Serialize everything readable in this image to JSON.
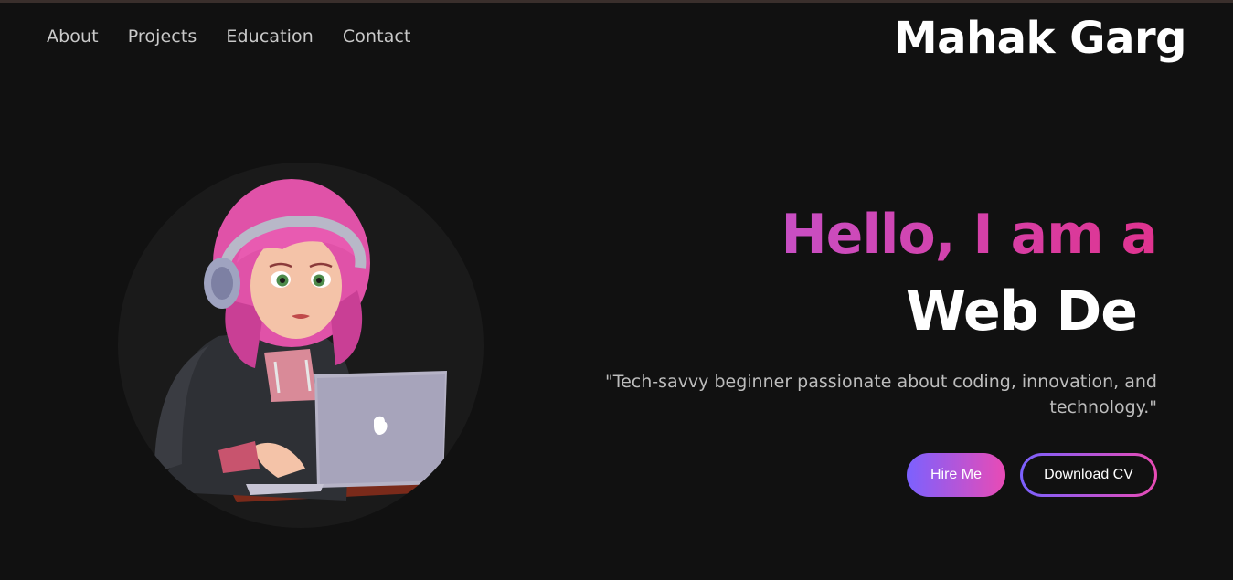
{
  "nav": {
    "items": [
      "About",
      "Projects",
      "Education",
      "Contact"
    ],
    "brand": "Mahak Garg"
  },
  "hero": {
    "greeting": "Hello, I am a",
    "role_typed": "Web De",
    "tagline_line1": "\"Tech-savvy beginner passionate about coding, innovation, and",
    "tagline_line2": "technology.\"",
    "hire_label": "Hire Me",
    "cv_label": "Download CV"
  },
  "colors": {
    "background": "#111111",
    "greeting_gradient_start": "#c84fc4",
    "greeting_gradient_end": "#e0338f",
    "button_gradient_start": "#7b61ff",
    "button_gradient_end": "#e94bb5"
  },
  "avatar": {
    "icon": "girl-with-headphones-laptop-avatar"
  }
}
